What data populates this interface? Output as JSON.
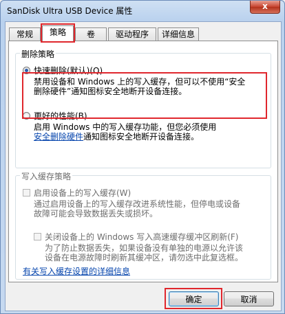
{
  "window": {
    "title": "SanDisk Ultra USB Device 属性",
    "close_label": "x"
  },
  "tabs": [
    {
      "label": "常规"
    },
    {
      "label": "策略"
    },
    {
      "label": "卷"
    },
    {
      "label": "驱动程序"
    },
    {
      "label": "详细信息"
    }
  ],
  "removal": {
    "group_label": "删除策略",
    "quick": {
      "label": "快速删除(默认)(Q)",
      "desc_line1": "禁用设备和 Windows 上的写入缓存，但可以不使用“安全",
      "desc_line2": "删除硬件”通知图标安全地断开设备连接。"
    },
    "better": {
      "label": "更好的性能(B)",
      "desc_line1": "启用 Windows 中的写入缓存功能，但您必须使用",
      "desc_link": "安全删除硬件",
      "desc_line2": "通知图标安全地断开设备连接。"
    }
  },
  "write_cache": {
    "group_label": "写入缓存策略",
    "enable": {
      "label": "启用设备上的写入缓存(W)",
      "desc_line1": "通过启用设备上的写入缓存改进系统性能，但停电或设备",
      "desc_line2": "故障可能会导致数据丢失或损坏。"
    },
    "flush": {
      "label": "关闭设备上的 Windows 写入高速缓存缓冲区刷新(F)",
      "desc_line1": "为了防止数据丢失，如果设备没有单独的电源以允许该",
      "desc_line2": "设备在电源故障时刷新其缓冲区，请勿选中此复选框。"
    }
  },
  "more_info_link": "有关写入缓存设置的详细信息",
  "buttons": {
    "ok": "确定",
    "cancel": "取消"
  }
}
